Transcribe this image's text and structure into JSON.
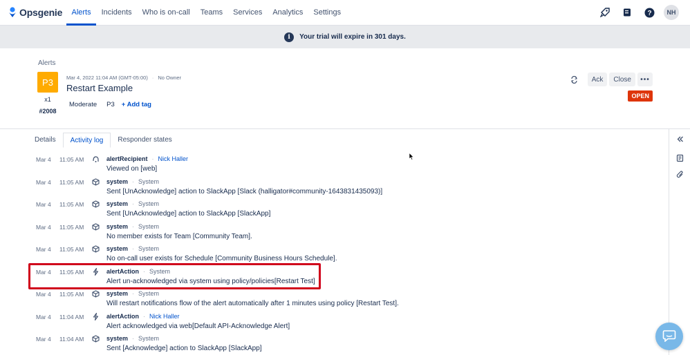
{
  "app": {
    "name": "Opsgenie"
  },
  "nav": {
    "items": [
      "Alerts",
      "Incidents",
      "Who is on-call",
      "Teams",
      "Services",
      "Analytics",
      "Settings"
    ],
    "active": "Alerts",
    "avatar_initials": "NH",
    "icons": [
      "rocket-icon",
      "book-icon",
      "help-icon"
    ]
  },
  "banner": {
    "text": "Your trial will expire in 301 days."
  },
  "alert": {
    "breadcrumb": "Alerts",
    "priority": "P3",
    "count": "x1",
    "tiny_id": "#2008",
    "created": "Mar 4, 2022 11:04 AM (GMT-05:00)",
    "owner": "No Owner",
    "title": "Restart Example",
    "tags": [
      "Moderate",
      "P3"
    ],
    "add_tag": "+ Add tag",
    "status": "OPEN",
    "ack_label": "Ack",
    "close_label": "Close",
    "more_label": "•••",
    "priority_color": "#ffab00",
    "status_color": "#de350b"
  },
  "tabs": [
    {
      "label": "Details",
      "active": false
    },
    {
      "label": "Activity log",
      "active": true
    },
    {
      "label": "Responder states",
      "active": false
    }
  ],
  "activity": [
    {
      "date": "Mar 4",
      "time": "11:05 AM",
      "icon": "recipient-icon",
      "actor": "alertRecipient",
      "source": "Nick Haller",
      "source_link": true,
      "message": "Viewed on [web]"
    },
    {
      "date": "Mar 4",
      "time": "11:05 AM",
      "icon": "system-icon",
      "actor": "system",
      "source": "System",
      "source_link": false,
      "message": "Sent [UnAcknowledge] action to SlackApp [Slack (halligator#community-1643831435093)]"
    },
    {
      "date": "Mar 4",
      "time": "11:05 AM",
      "icon": "system-icon",
      "actor": "system",
      "source": "System",
      "source_link": false,
      "message": "Sent [UnAcknowledge] action to SlackApp [SlackApp]"
    },
    {
      "date": "Mar 4",
      "time": "11:05 AM",
      "icon": "system-icon",
      "actor": "system",
      "source": "System",
      "source_link": false,
      "message": "No member exists for Team [Community Team]."
    },
    {
      "date": "Mar 4",
      "time": "11:05 AM",
      "icon": "system-icon",
      "actor": "system",
      "source": "System",
      "source_link": false,
      "message": "No on-call user exists for Schedule [Community Business Hours Schedule]."
    },
    {
      "date": "Mar 4",
      "time": "11:05 AM",
      "icon": "action-icon",
      "actor": "alertAction",
      "source": "System",
      "source_link": false,
      "message": "Alert un-acknowledged via system using policy/policies[Restart Test]"
    },
    {
      "date": "Mar 4",
      "time": "11:05 AM",
      "icon": "system-icon",
      "actor": "system",
      "source": "System",
      "source_link": false,
      "message": "Will restart notifications flow of the alert automatically after 1 minutes using policy [Restart Test]."
    },
    {
      "date": "Mar 4",
      "time": "11:04 AM",
      "icon": "action-icon",
      "actor": "alertAction",
      "source": "Nick Haller",
      "source_link": true,
      "message": "Alert acknowledged via web[Default API-Acknowledge Alert]"
    },
    {
      "date": "Mar 4",
      "time": "11:04 AM",
      "icon": "system-icon",
      "actor": "system",
      "source": "System",
      "source_link": false,
      "message": "Sent [Acknowledge] action to SlackApp [SlackApp]"
    }
  ],
  "highlight_row_index": 5,
  "colors": {
    "accent": "#0052cc",
    "highlight": "#d0021b"
  }
}
